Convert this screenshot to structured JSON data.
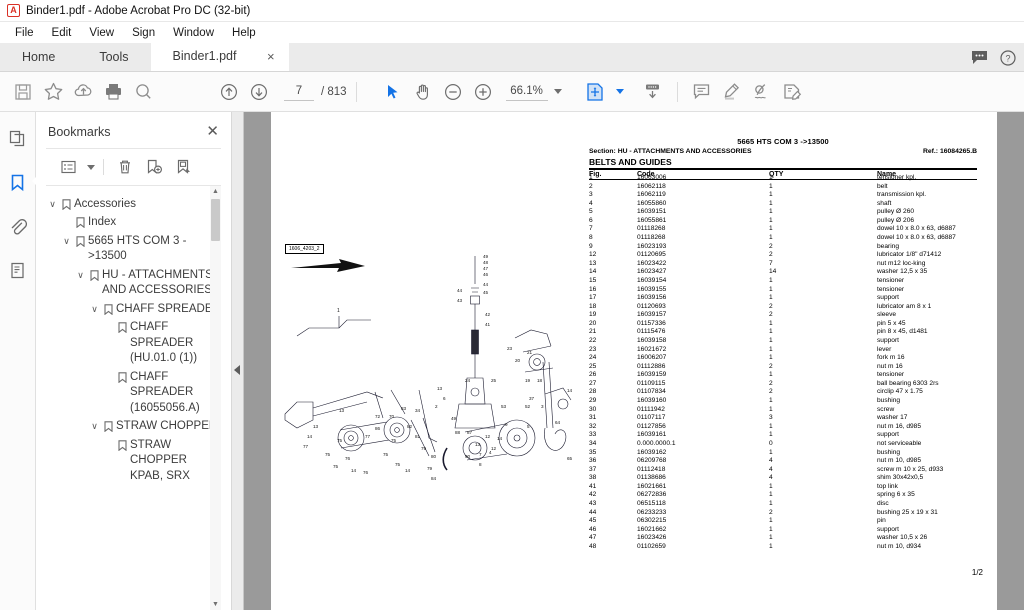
{
  "window": {
    "title": "Binder1.pdf - Adobe Acrobat Pro DC (32-bit)",
    "logo_letter": "A"
  },
  "menu": {
    "items": [
      "File",
      "Edit",
      "View",
      "Sign",
      "Window",
      "Help"
    ]
  },
  "tabs": {
    "home": "Home",
    "tools": "Tools",
    "document": "Binder1.pdf",
    "close_label": "×"
  },
  "toolbar": {
    "save_title": "Save",
    "star_title": "Add to favorites",
    "cloud_title": "Save to cloud",
    "print_title": "Print",
    "search_title": "Find",
    "prev_title": "Previous page",
    "next_title": "Next page",
    "page_value": "7",
    "page_total": "/ 813",
    "select_title": "Select tool",
    "hand_title": "Hand tool",
    "zoom_out_title": "Zoom out",
    "zoom_in_title": "Zoom in",
    "zoom_value": "66.1%",
    "fit_title": "Fit page",
    "scroll_title": "Scroll mode",
    "comment_title": "Comment",
    "highlight_title": "Highlight text",
    "sign_title": "Sign",
    "fillsign_title": "Fill & Sign"
  },
  "rail": {
    "thumbnails": "page-thumbnails",
    "bookmarks": "bookmarks",
    "attachments": "attachments",
    "layers": "layers"
  },
  "bookmarks": {
    "title": "Bookmarks",
    "close": "✕",
    "tools": {
      "options": "options",
      "delete": "delete-bookmark",
      "new": "new-bookmark",
      "edit": "edit-bookmark"
    },
    "items": [
      {
        "label": "Accessories",
        "indent": 0,
        "twisty": "∨"
      },
      {
        "label": "Index",
        "indent": 1,
        "twisty": ""
      },
      {
        "label": "5665 HTS COM 3 ->13500",
        "indent": 1,
        "twisty": "∨"
      },
      {
        "label": "HU - ATTACHMENTS AND ACCESSORIES",
        "indent": 2,
        "twisty": "∨"
      },
      {
        "label": "CHAFF SPREADER",
        "indent": 3,
        "twisty": "∨"
      },
      {
        "label": "CHAFF SPREADER (HU.01.0 (1))",
        "indent": 4,
        "twisty": ""
      },
      {
        "label": "CHAFF SPREADER (16055056.A)",
        "indent": 4,
        "twisty": ""
      },
      {
        "label": "STRAW CHOPPER",
        "indent": 3,
        "twisty": "∨"
      },
      {
        "label": "STRAW CHOPPER KPAB, SRX",
        "indent": 4,
        "twisty": ""
      }
    ]
  },
  "document": {
    "model": "5665 HTS COM 3 ->13500",
    "section": "Section: HU - ATTACHMENTS AND ACCESSORIES",
    "ref": "Ref.: 16084265.B",
    "group_title": "BELTS AND GUIDES",
    "columns": [
      "Fig.",
      "Code",
      "QTY",
      "Name"
    ],
    "page_indicator": "1/2",
    "diagram_tag": "1606_4203_2",
    "rows": [
      {
        "fig": "1",
        "code": "16063006",
        "qty": "1",
        "name": "tensioner kpl."
      },
      {
        "fig": "2",
        "code": "16062118",
        "qty": "1",
        "name": "belt"
      },
      {
        "fig": "3",
        "code": "16062119",
        "qty": "1",
        "name": "transmission kpl."
      },
      {
        "fig": "4",
        "code": "16055860",
        "qty": "1",
        "name": "shaft"
      },
      {
        "fig": "5",
        "code": "16039151",
        "qty": "1",
        "name": "pulley Ø 260"
      },
      {
        "fig": "6",
        "code": "16055861",
        "qty": "1",
        "name": "pulley Ø 206"
      },
      {
        "fig": "7",
        "code": "01118268",
        "qty": "1",
        "name": "dowel 10 x 8.0 x 63, d6887"
      },
      {
        "fig": "8",
        "code": "01118268",
        "qty": "1",
        "name": "dowel 10 x 8.0 x 63, d6887"
      },
      {
        "fig": "9",
        "code": "16023193",
        "qty": "2",
        "name": "bearing"
      },
      {
        "fig": "12",
        "code": "01120695",
        "qty": "2",
        "name": "lubricator 1/8\" d71412"
      },
      {
        "fig": "13",
        "code": "16023422",
        "qty": "7",
        "name": "nut m12 loc-king"
      },
      {
        "fig": "14",
        "code": "16023427",
        "qty": "14",
        "name": "washer 12,5 x 35"
      },
      {
        "fig": "15",
        "code": "16039154",
        "qty": "1",
        "name": "tensioner"
      },
      {
        "fig": "16",
        "code": "16039155",
        "qty": "1",
        "name": "tensioner"
      },
      {
        "fig": "17",
        "code": "16039156",
        "qty": "1",
        "name": "support"
      },
      {
        "fig": "18",
        "code": "01120693",
        "qty": "2",
        "name": "lubricator am 8 x 1"
      },
      {
        "fig": "19",
        "code": "16039157",
        "qty": "2",
        "name": "sleeve"
      },
      {
        "fig": "20",
        "code": "01157336",
        "qty": "1",
        "name": "pin 5 x 45"
      },
      {
        "fig": "21",
        "code": "01115476",
        "qty": "1",
        "name": "pin 8 x 45, d1481"
      },
      {
        "fig": "22",
        "code": "16039158",
        "qty": "1",
        "name": "support"
      },
      {
        "fig": "23",
        "code": "16021672",
        "qty": "1",
        "name": "lever"
      },
      {
        "fig": "24",
        "code": "16006207",
        "qty": "1",
        "name": "fork m 16"
      },
      {
        "fig": "25",
        "code": "01112886",
        "qty": "2",
        "name": "nut m 16"
      },
      {
        "fig": "26",
        "code": "16039159",
        "qty": "1",
        "name": "tensioner"
      },
      {
        "fig": "27",
        "code": "01109115",
        "qty": "2",
        "name": "ball bearing 6303 2rs"
      },
      {
        "fig": "28",
        "code": "01107834",
        "qty": "2",
        "name": "circlip 47 x 1.75"
      },
      {
        "fig": "29",
        "code": "16039160",
        "qty": "1",
        "name": "bushing"
      },
      {
        "fig": "30",
        "code": "01111942",
        "qty": "1",
        "name": "screw"
      },
      {
        "fig": "31",
        "code": "01107117",
        "qty": "3",
        "name": "washer 17"
      },
      {
        "fig": "32",
        "code": "01127856",
        "qty": "1",
        "name": "nut m 16, d985"
      },
      {
        "fig": "33",
        "code": "16039161",
        "qty": "1",
        "name": "support"
      },
      {
        "fig": "34",
        "code": "0.000.0000.1",
        "qty": "0",
        "name": "not serviceable"
      },
      {
        "fig": "35",
        "code": "16039162",
        "qty": "1",
        "name": "bushing"
      },
      {
        "fig": "36",
        "code": "06209768",
        "qty": "4",
        "name": "nut m 10, d985"
      },
      {
        "fig": "37",
        "code": "01112418",
        "qty": "4",
        "name": "screw m 10 x 25, d933"
      },
      {
        "fig": "38",
        "code": "01138686",
        "qty": "4",
        "name": "shim 30x42x0,5"
      },
      {
        "fig": "41",
        "code": "16021661",
        "qty": "1",
        "name": "top link"
      },
      {
        "fig": "42",
        "code": "06272836",
        "qty": "1",
        "name": "spring 6 x 35"
      },
      {
        "fig": "43",
        "code": "06515118",
        "qty": "1",
        "name": "disc"
      },
      {
        "fig": "44",
        "code": "06233233",
        "qty": "2",
        "name": "bushing 25 x 19 x 31"
      },
      {
        "fig": "45",
        "code": "06302215",
        "qty": "1",
        "name": "pin"
      },
      {
        "fig": "46",
        "code": "16021662",
        "qty": "1",
        "name": "support"
      },
      {
        "fig": "47",
        "code": "16023426",
        "qty": "1",
        "name": "washer 10,5 x 26"
      },
      {
        "fig": "48",
        "code": "01102659",
        "qty": "1",
        "name": "nut m 10, d934"
      }
    ]
  }
}
